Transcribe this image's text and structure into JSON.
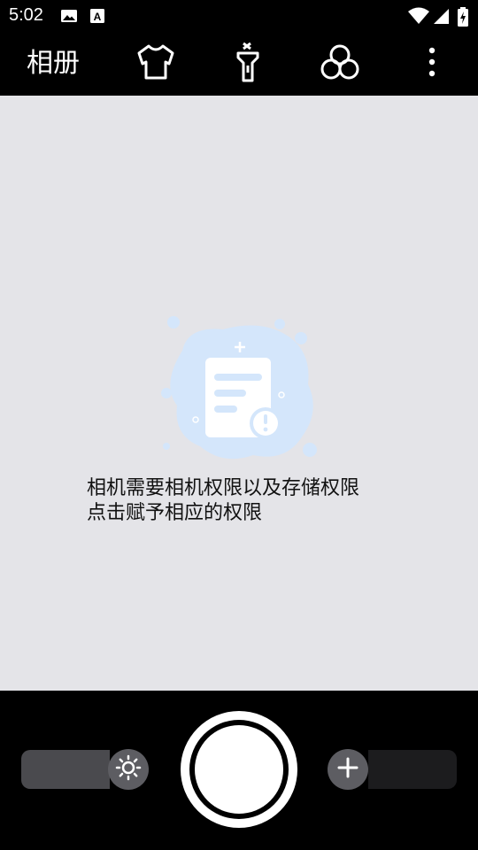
{
  "status_bar": {
    "time": "5:02",
    "icons": [
      "image-notification-icon",
      "font-notification-icon",
      "wifi-icon",
      "signal-icon",
      "battery-charging-icon"
    ]
  },
  "toolbar": {
    "album_label": "相册",
    "icons": [
      "shirt-icon",
      "flashlight-icon",
      "filter-circles-icon",
      "more-vert-icon"
    ]
  },
  "preview": {
    "message_line1": "相机需要相机权限以及存储权限",
    "message_line2": "点击赋予相应的权限",
    "illustration": "document-alert-illustration"
  },
  "bottom": {
    "left_control_icon": "brightness-icon",
    "right_control_icon": "zoom-in-icon",
    "shutter": "shutter-button"
  },
  "colors": {
    "preview_bg": "#e4e4e8",
    "illustration_accent": "#d4e6fb"
  }
}
